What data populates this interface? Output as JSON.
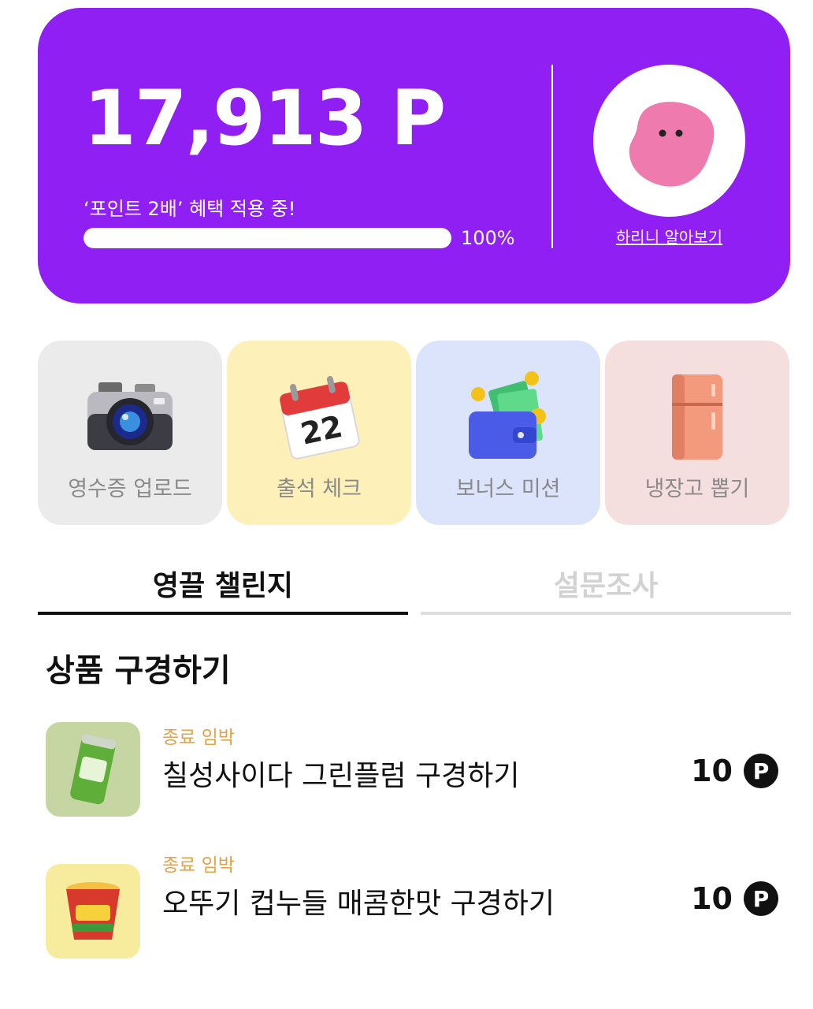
{
  "points": {
    "value": "17,913 P",
    "benefit_text": "‘포인트 2배’ 혜택 적용 중!",
    "progress_fraction": 1.0,
    "progress_label": "100%",
    "character_link": "하리니 알아보기"
  },
  "shortcuts": [
    {
      "label": "영수증 업로드",
      "icon": "camera-icon",
      "bg": "#ebebeb"
    },
    {
      "label": "출석 체크",
      "icon": "calendar-icon",
      "calendar_day": "22",
      "bg": "#fdf0b8"
    },
    {
      "label": "보너스 미션",
      "icon": "wallet-icon",
      "bg": "#dbe4fb"
    },
    {
      "label": "냉장고 뽑기",
      "icon": "fridge-icon",
      "bg": "#f5dfde"
    }
  ],
  "tabs": [
    {
      "label": "영끌 챌린지",
      "active": true
    },
    {
      "label": "설문조사",
      "active": false
    }
  ],
  "section_title": "상품 구경하기",
  "products": [
    {
      "badge": "종료 임박",
      "name": "칠성사이다 그린플럼 구경하기",
      "reward": "10",
      "reward_icon": "P",
      "thumb_bg": "#c6d6a2",
      "thumb_icon": "soda-can-icon"
    },
    {
      "badge": "종료 임박",
      "name": "오뚜기 컵누들 매콤한맛 구경하기",
      "reward": "10",
      "reward_icon": "P",
      "thumb_bg": "#f7ec9e",
      "thumb_icon": "cup-noodle-icon"
    }
  ],
  "colors": {
    "brand_purple": "#8f1ff2",
    "badge_orange": "#e4a247",
    "character_pink": "#ef7aae"
  }
}
